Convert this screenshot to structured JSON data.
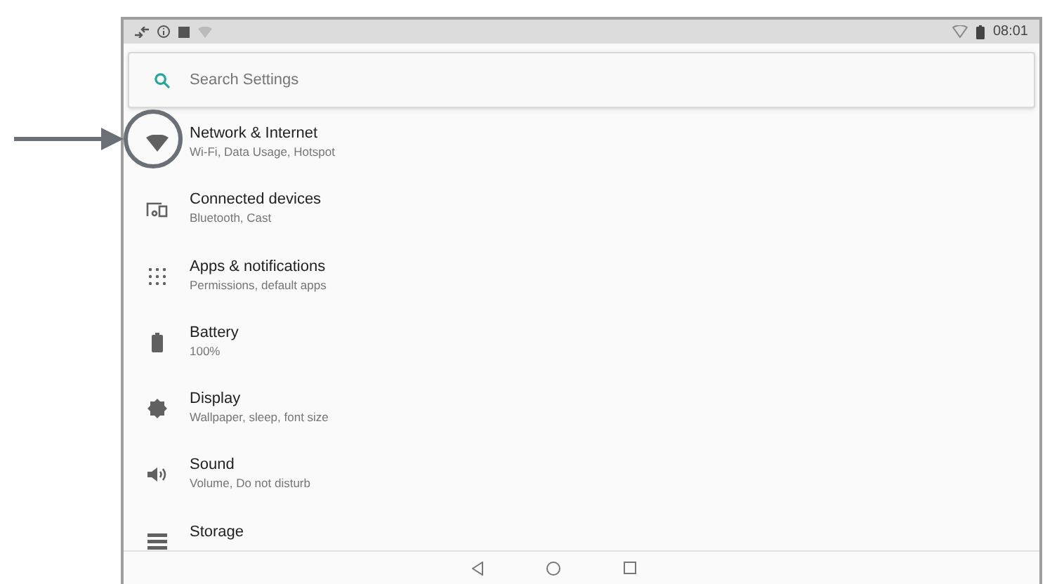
{
  "status_bar": {
    "time": "08:01"
  },
  "search": {
    "placeholder": "Search Settings"
  },
  "items": [
    {
      "title": "Network & Internet",
      "subtitle": "Wi-Fi, Data Usage, Hotspot",
      "kind": "wifi",
      "highlighted": true
    },
    {
      "title": "Connected devices",
      "subtitle": "Bluetooth, Cast",
      "kind": "devices",
      "highlighted": false
    },
    {
      "title": "Apps & notifications",
      "subtitle": "Permissions, default apps",
      "kind": "apps",
      "highlighted": false
    },
    {
      "title": "Battery",
      "subtitle": "100%",
      "kind": "battery",
      "highlighted": false
    },
    {
      "title": "Display",
      "subtitle": "Wallpaper, sleep, font size",
      "kind": "display",
      "highlighted": false
    },
    {
      "title": "Sound",
      "subtitle": "Volume, Do not disturb",
      "kind": "sound",
      "highlighted": false
    },
    {
      "title": "Storage",
      "kind": "storage",
      "highlighted": false
    }
  ]
}
